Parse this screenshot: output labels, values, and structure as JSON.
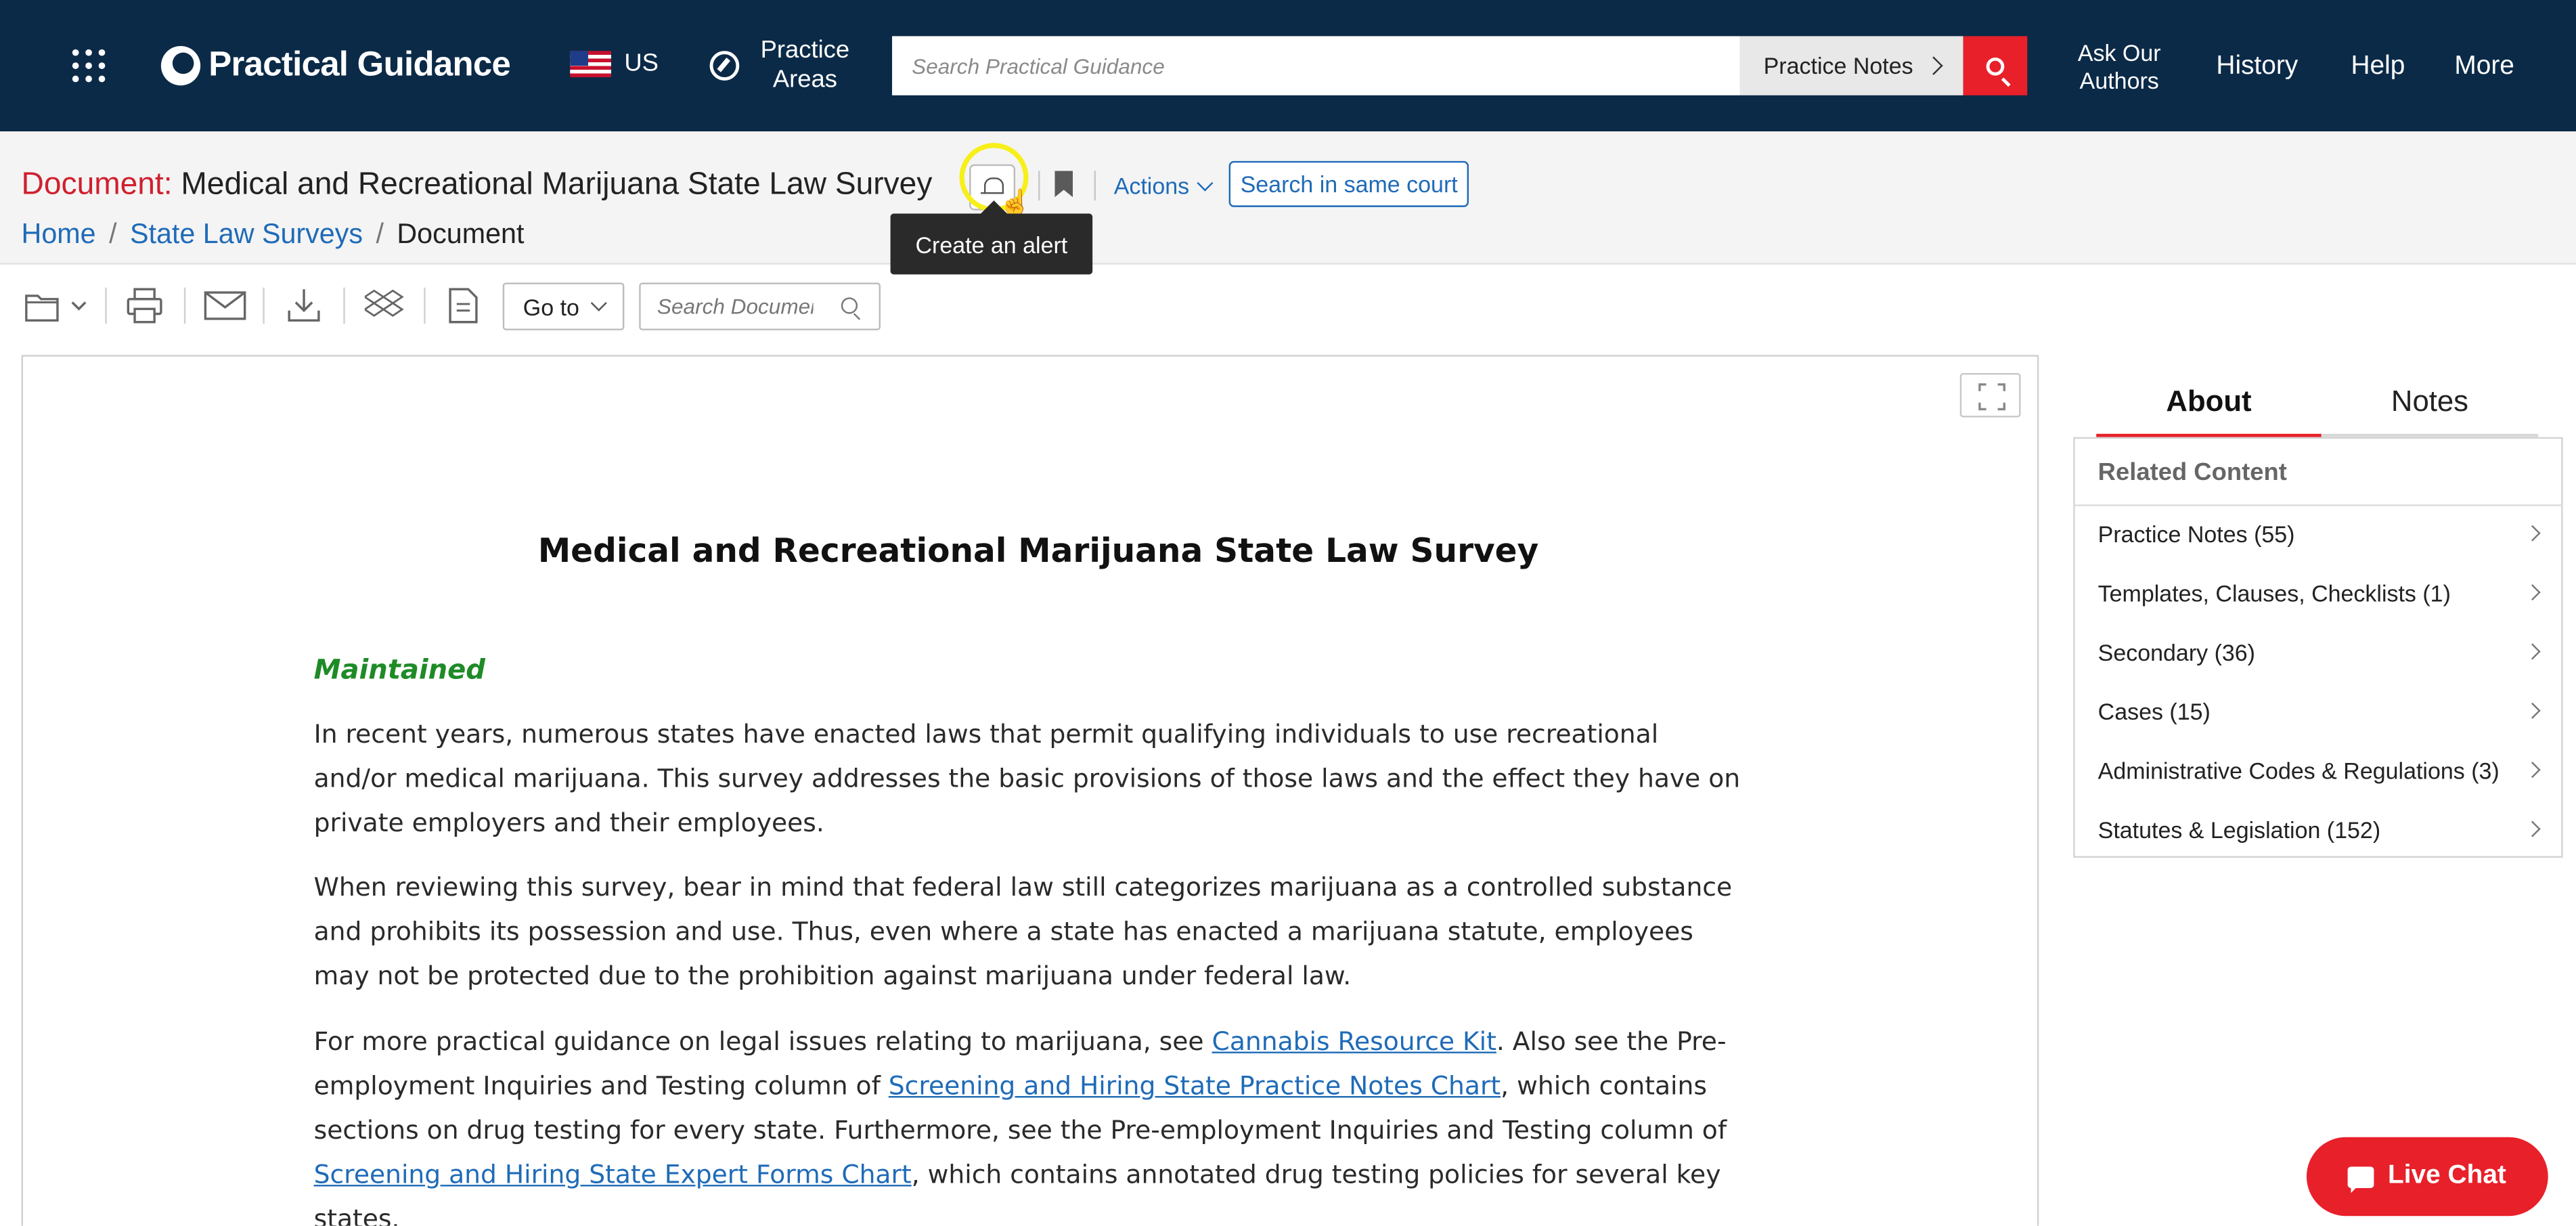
{
  "header": {
    "brand": "Practical Guidance",
    "region": "US",
    "practice_areas": "Practice Areas",
    "search": {
      "placeholder": "Search Practical Guidance",
      "type": "Practice Notes"
    },
    "ask_authors": "Ask Our Authors",
    "history": "History",
    "help": "Help",
    "more": "More"
  },
  "doc_header": {
    "label": "Document:",
    "title": "Medical and Recreational Marijuana State Law Survey",
    "actions": "Actions",
    "search_same_court": "Search in same court",
    "tooltip": "Create an alert",
    "breadcrumb": [
      "Home",
      "State Law Surveys",
      "Document"
    ]
  },
  "toolbar": {
    "goto": "Go to",
    "search_placeholder": "Search Document"
  },
  "document": {
    "heading": "Medical and Recreational Marijuana State Law Survey",
    "status": "Maintained",
    "p1": "In recent years, numerous states have enacted laws that permit qualifying individuals to use recreational and/or medical marijuana. This survey addresses the basic provisions of those laws and the effect they have on private employers and their employees.",
    "p2": "When reviewing this survey, bear in mind that federal law still categorizes marijuana as a controlled substance and prohibits its possession and use. Thus, even where a state has enacted a marijuana statute, employees may not be protected due to the prohibition against marijuana under federal law.",
    "p3_a": "For more practical guidance on legal issues relating to marijuana, see ",
    "p3_link1": "Cannabis Resource Kit",
    "p3_b": ". Also see the Pre-employment Inquiries and Testing column of ",
    "p3_link2": "Screening and Hiring State Practice Notes Chart",
    "p3_c": ", which contains sections on drug testing for every state. Furthermore, see the Pre-employment Inquiries and Testing column of ",
    "p3_link3": "Screening and Hiring State Expert Forms Chart",
    "p3_d": ", which contains annotated drug testing policies for several key states."
  },
  "sidebar": {
    "tabs": [
      "About",
      "Notes"
    ],
    "related_title": "Related Content",
    "items": [
      "Practice Notes (55)",
      "Templates, Clauses, Checklists (1)",
      "Secondary (36)",
      "Cases (15)",
      "Administrative Codes & Regulations (3)",
      "Statutes & Legislation (152)"
    ]
  },
  "live_chat": "Live Chat",
  "icons": [
    "apps-grid-icon",
    "brand-logo-icon",
    "us-flag-icon",
    "compass-icon",
    "search-icon",
    "bell-icon",
    "bookmark-icon",
    "folder-icon",
    "print-icon",
    "email-icon",
    "download-icon",
    "dropbox-icon",
    "annotate-icon",
    "expand-icon",
    "chat-icon"
  ],
  "colors": {
    "nav_bg": "#0b2a47",
    "accent_red": "#e8202a",
    "link_blue": "#1f6bb8",
    "maintained_green": "#1e8b26",
    "highlight_yellow": "#f7ef1a"
  }
}
